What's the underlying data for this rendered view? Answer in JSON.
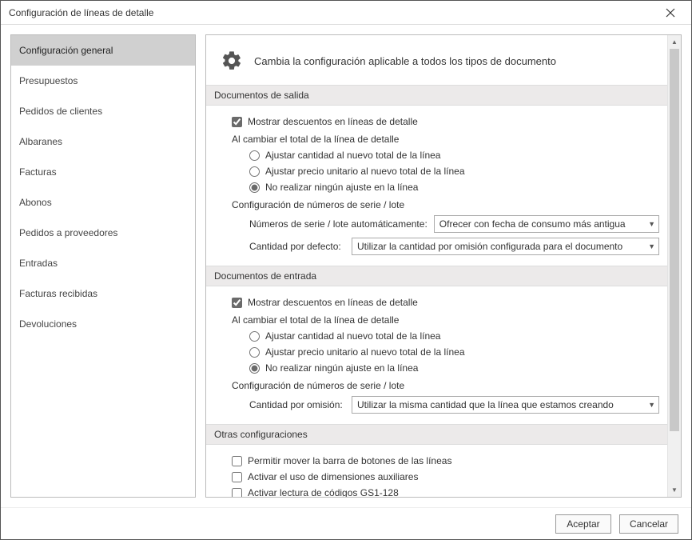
{
  "window": {
    "title": "Configuración de líneas de detalle"
  },
  "sidebar": {
    "items": [
      {
        "label": "Configuración general"
      },
      {
        "label": "Presupuestos"
      },
      {
        "label": "Pedidos de clientes"
      },
      {
        "label": "Albaranes"
      },
      {
        "label": "Facturas"
      },
      {
        "label": "Abonos"
      },
      {
        "label": "Pedidos a proveedores"
      },
      {
        "label": "Entradas"
      },
      {
        "label": "Facturas recibidas"
      },
      {
        "label": "Devoluciones"
      }
    ],
    "selected_index": 0
  },
  "main": {
    "header_title": "Cambia la configuración aplicable a todos los tipos de documento",
    "sections": {
      "salida": {
        "title": "Documentos de salida",
        "show_discounts_label": "Mostrar descuentos en líneas de detalle",
        "show_discounts_checked": true,
        "on_change_total_label": "Al cambiar el total de la línea de detalle",
        "radios": {
          "adjust_qty": "Ajustar cantidad al nuevo total de la línea",
          "adjust_price": "Ajustar precio unitario al nuevo total de la línea",
          "no_adjust": "No realizar ningún ajuste en la línea"
        },
        "radio_selected": "no_adjust",
        "serial_config_title": "Configuración de números de serie / lote",
        "serial_auto_label": "Números de serie / lote automáticamente:",
        "serial_auto_value": "Ofrecer con fecha de consumo más antigua",
        "qty_default_label": "Cantidad por defecto:",
        "qty_default_value": "Utilizar la cantidad por omisión configurada para el documento"
      },
      "entrada": {
        "title": "Documentos de entrada",
        "show_discounts_label": "Mostrar descuentos en líneas de detalle",
        "show_discounts_checked": true,
        "on_change_total_label": "Al cambiar el total de la línea de detalle",
        "radios": {
          "adjust_qty": "Ajustar cantidad al nuevo total de la línea",
          "adjust_price": "Ajustar precio unitario al nuevo total de la línea",
          "no_adjust": "No realizar ningún ajuste en la línea"
        },
        "radio_selected": "no_adjust",
        "serial_config_title": "Configuración de números de serie / lote",
        "qty_default_label": "Cantidad por omisión:",
        "qty_default_value": "Utilizar la misma cantidad que la línea que estamos creando"
      },
      "otras": {
        "title": "Otras configuraciones",
        "opt_move_bar": "Permitir mover la barra de botones de las líneas",
        "opt_move_bar_checked": false,
        "opt_aux_dims": "Activar el uso de dimensiones auxiliares",
        "opt_aux_dims_checked": false,
        "opt_gs1": "Activar lectura de códigos GS1-128",
        "opt_gs1_checked": false
      }
    }
  },
  "footer": {
    "accept": "Aceptar",
    "cancel": "Cancelar"
  }
}
